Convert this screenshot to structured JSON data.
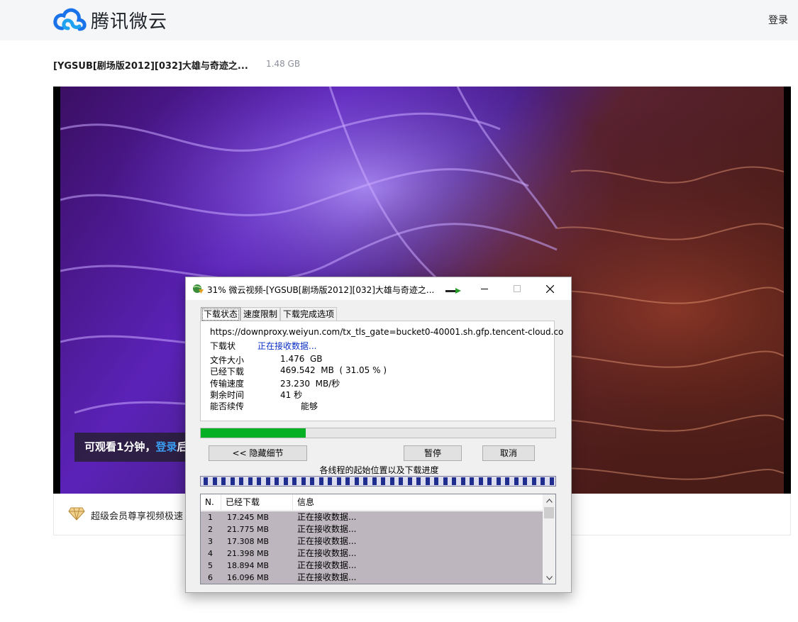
{
  "header": {
    "brand": "腾讯微云",
    "login": "登录"
  },
  "file": {
    "title": "[YGSUB[剧场版2012][032]大雄与奇迹之...",
    "size": "1.48 GB"
  },
  "player": {
    "preview_prefix": "可观看1分钟，",
    "preview_link": "登录",
    "preview_suffix": "后"
  },
  "vip": {
    "text": "超级会员尊享视频极速"
  },
  "dialog": {
    "title": "31% 微云视频-[YGSUB[剧场版2012][032]大雄与奇迹之...",
    "tabs": [
      {
        "label": "下载状态",
        "active": true
      },
      {
        "label": "速度限制",
        "active": false
      },
      {
        "label": "下载完成选项",
        "active": false
      }
    ],
    "url": "https://downproxy.weiyun.com/tx_tls_gate=bucket0-40001.sh.gfp.tencent-cloud.co",
    "status_label": "下载状",
    "status_value": "正在接收数据...",
    "rows": [
      {
        "label": "文件大小",
        "value": "1.476  GB"
      },
      {
        "label": "已经下载",
        "value": "469.542  MB  ( 31.05 % )"
      },
      {
        "label": "传输速度",
        "value": "23.230  MB/秒"
      },
      {
        "label": "剩余时间",
        "value": "41 秒"
      },
      {
        "label": "能否续传",
        "value": "能够"
      }
    ],
    "progress": 0.295,
    "buttons": {
      "hide": "<< 隐藏细节",
      "pause": "暂停",
      "cancel": "取消"
    },
    "segments_caption": "各线程的起始位置以及下载进度",
    "thread_columns": [
      "N.",
      "已经下载",
      "信息"
    ],
    "threads": [
      {
        "n": "1",
        "downloaded": "17.245  MB",
        "info": "正在接收数据..."
      },
      {
        "n": "2",
        "downloaded": "21.775  MB",
        "info": "正在接收数据..."
      },
      {
        "n": "3",
        "downloaded": "17.308  MB",
        "info": "正在接收数据..."
      },
      {
        "n": "4",
        "downloaded": "21.398  MB",
        "info": "正在接收数据..."
      },
      {
        "n": "5",
        "downloaded": "18.894  MB",
        "info": "正在接收数据..."
      },
      {
        "n": "6",
        "downloaded": "16.096  MB",
        "info": "正在接收数据..."
      }
    ]
  },
  "colors": {
    "progress_green": "#06b025",
    "link_blue": "#3a9cf0",
    "status_blue": "#0a2fc4",
    "segment_blue": "#1f2d8e"
  }
}
